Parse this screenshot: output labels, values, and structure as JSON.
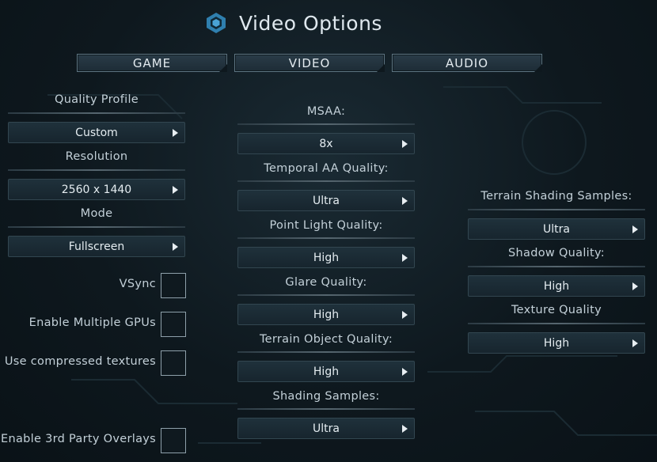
{
  "header": {
    "title": "Video Options",
    "logo_icon": "hexagon-logo-icon"
  },
  "tabs": [
    {
      "label": "GAME"
    },
    {
      "label": "VIDEO"
    },
    {
      "label": "AUDIO"
    }
  ],
  "left": {
    "quality_profile": {
      "label": "Quality Profile",
      "value": "Custom"
    },
    "resolution": {
      "label": "Resolution",
      "value": "2560 x 1440"
    },
    "mode": {
      "label": "Mode",
      "value": "Fullscreen"
    },
    "checkboxes": [
      {
        "label": "VSync",
        "checked": false
      },
      {
        "label": "Enable Multiple GPUs",
        "checked": false
      },
      {
        "label": "Use compressed textures",
        "checked": false
      },
      {
        "label": "Enable 3rd Party Overlays",
        "checked": false
      }
    ]
  },
  "middle": {
    "msaa": {
      "label": "MSAA:",
      "value": "8x"
    },
    "temporal_aa": {
      "label": "Temporal AA Quality:",
      "value": "Ultra"
    },
    "point_light": {
      "label": "Point Light Quality:",
      "value": "High"
    },
    "glare": {
      "label": "Glare Quality:",
      "value": "High"
    },
    "terrain_object": {
      "label": "Terrain Object Quality:",
      "value": "High"
    },
    "shading_samples": {
      "label": "Shading Samples:",
      "value": "Ultra"
    }
  },
  "right": {
    "terrain_shading": {
      "label": "Terrain Shading Samples:",
      "value": "Ultra"
    },
    "shadow": {
      "label": "Shadow Quality:",
      "value": "High"
    },
    "texture": {
      "label": "Texture Quality",
      "value": "High"
    }
  }
}
